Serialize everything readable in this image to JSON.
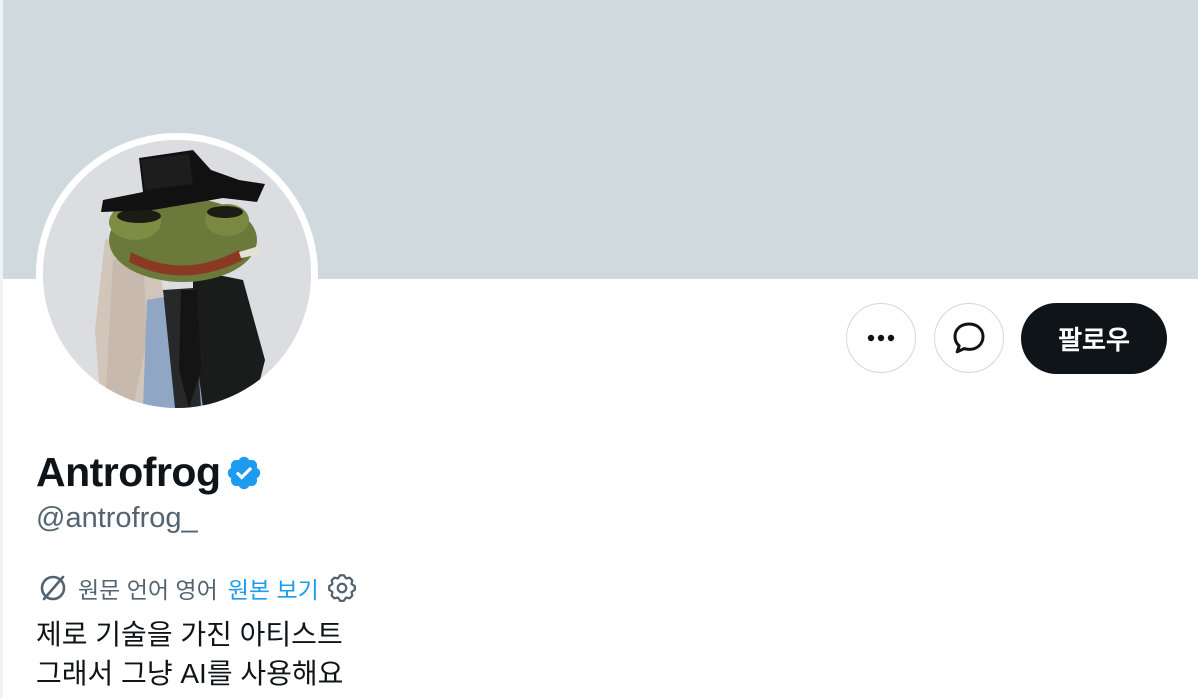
{
  "profile": {
    "display_name": "Antrofrog",
    "handle": "@antrofrog_",
    "verified_icon": "verified-badge-icon",
    "verified_color": "#1d9bf0",
    "bio_line_1": "제로 기술을 가진 아티스트",
    "bio_line_2": "그래서 그냥 AI를 사용해요"
  },
  "actions": {
    "more_icon": "more-icon",
    "message_icon": "message-bubble-icon",
    "follow_label": "팔로우"
  },
  "translation": {
    "icon": "translate-off-icon",
    "language_text": "원문 언어 영어",
    "view_original_label": "원본 보기",
    "settings_icon": "gear-icon",
    "link_color": "#1d9bf0"
  },
  "colors": {
    "banner": "#cfd9de",
    "primary_text": "#0f1419",
    "secondary_text": "#536471",
    "follow_button_bg": "#0f1419"
  }
}
